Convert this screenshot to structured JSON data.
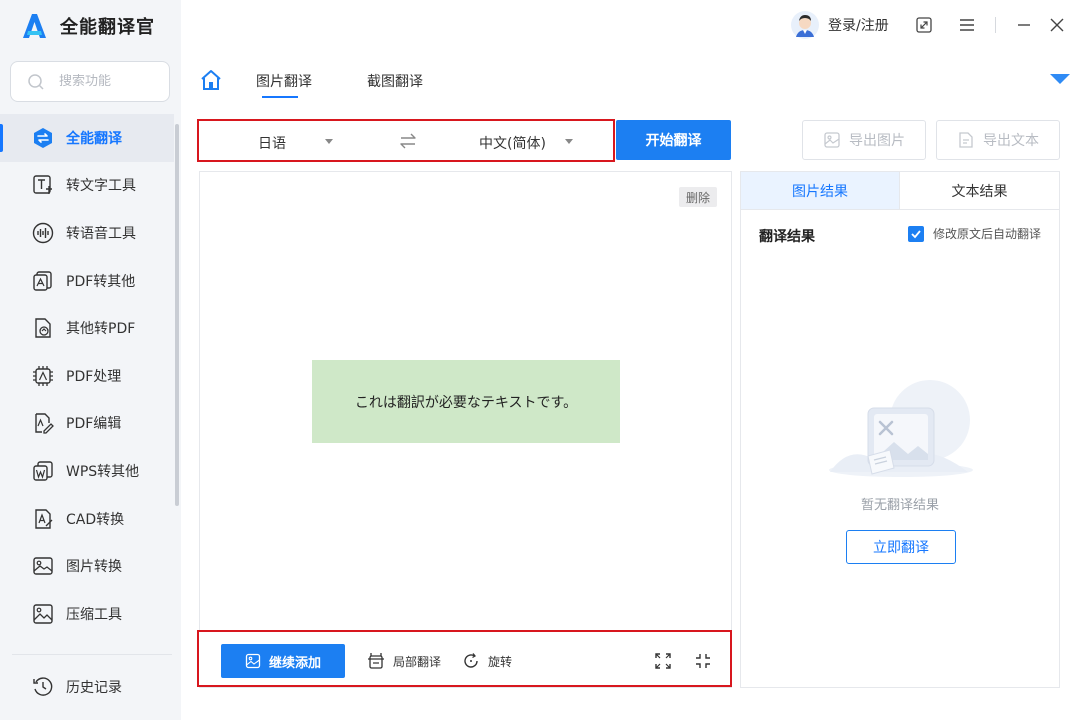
{
  "app": {
    "title": "全能翻译官"
  },
  "search": {
    "placeholder": "搜索功能"
  },
  "sidebar": {
    "items": [
      {
        "label": "全能翻译",
        "icon": "translate-icon",
        "active": true
      },
      {
        "label": "转文字工具",
        "icon": "text-tool-icon"
      },
      {
        "label": "转语音工具",
        "icon": "voice-tool-icon"
      },
      {
        "label": "PDF转其他",
        "icon": "pdf-to-other-icon"
      },
      {
        "label": "其他转PDF",
        "icon": "other-to-pdf-icon"
      },
      {
        "label": "PDF处理",
        "icon": "pdf-process-icon"
      },
      {
        "label": "PDF编辑",
        "icon": "pdf-edit-icon"
      },
      {
        "label": "WPS转其他",
        "icon": "wps-icon"
      },
      {
        "label": "CAD转换",
        "icon": "cad-icon"
      },
      {
        "label": "图片转换",
        "icon": "image-convert-icon"
      },
      {
        "label": "压缩工具",
        "icon": "compress-icon"
      }
    ],
    "history": "历史记录"
  },
  "header": {
    "login": "登录/注册"
  },
  "tabs": [
    {
      "label": "图片翻译",
      "active": true
    },
    {
      "label": "截图翻译",
      "active": false
    }
  ],
  "translate": {
    "source_lang": "日语",
    "target_lang": "中文(简体)",
    "start": "开始翻译",
    "export_image": "导出图片",
    "export_text": "导出文本"
  },
  "image_panel": {
    "delete": "删除",
    "image_text": "これは翻訳が必要なテキストです。",
    "continue_add": "继续添加",
    "partial_translate": "局部翻译",
    "rotate": "旋转"
  },
  "result_panel": {
    "tab_image": "图片结果",
    "tab_text": "文本结果",
    "title": "翻译结果",
    "auto_label": "修改原文后自动翻译",
    "auto_checked": true,
    "empty": "暂无翻译结果",
    "translate_now": "立即翻译"
  },
  "colors": {
    "accent": "#1c7ff2",
    "highlight": "#d8171e",
    "image_bg": "#cfe8c8"
  }
}
